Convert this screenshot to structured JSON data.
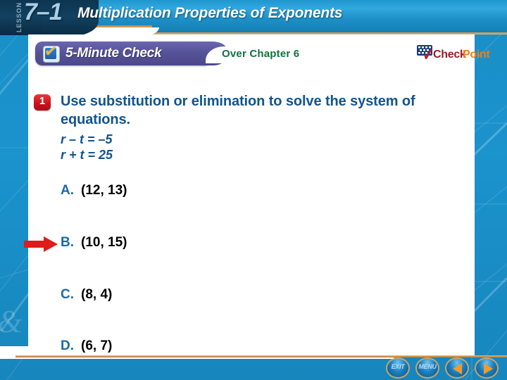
{
  "header": {
    "lesson_label": "LESSON",
    "lesson_number": "7–1",
    "title": "Multiplication Properties of Exponents"
  },
  "check_bar": {
    "pill_label": "5-Minute Check",
    "checkbox_icon": "checkbox-checked-icon",
    "over_label": "Over Chapter 6",
    "logo": {
      "check_text": "Check",
      "point_text": "Point",
      "checkmark_icon": "red-checkmark-icon",
      "flag_icon": "flag-icon"
    }
  },
  "question": {
    "number": "1",
    "prompt": "Use substitution or elimination to solve the system of equations.",
    "equations": [
      "r – t = –5",
      "r + t = 25"
    ]
  },
  "choices": [
    {
      "letter": "A.",
      "value": "(12, 13)"
    },
    {
      "letter": "B.",
      "value": "(10, 15)"
    },
    {
      "letter": "C.",
      "value": "(8, 4)"
    },
    {
      "letter": "D.",
      "value": "(6, 7)"
    }
  ],
  "pointer": {
    "icon": "right-arrow-icon",
    "points_to": "B.",
    "color": "#e01b1b"
  },
  "nav": {
    "exit_label": "EXIT",
    "menu_label": "MENU",
    "prev_icon": "triangle-left-icon",
    "next_icon": "triangle-right-icon"
  },
  "colors": {
    "frame_blue": "#1a8ec6",
    "header_blue": "#1f95ce",
    "pill_purple": "#565297",
    "question_blue": "#10558f",
    "choice_letter_blue": "#1b6aa8",
    "over_green": "#12723f",
    "gold_rule": "#c78c44",
    "badge_red": "#c9141f"
  }
}
